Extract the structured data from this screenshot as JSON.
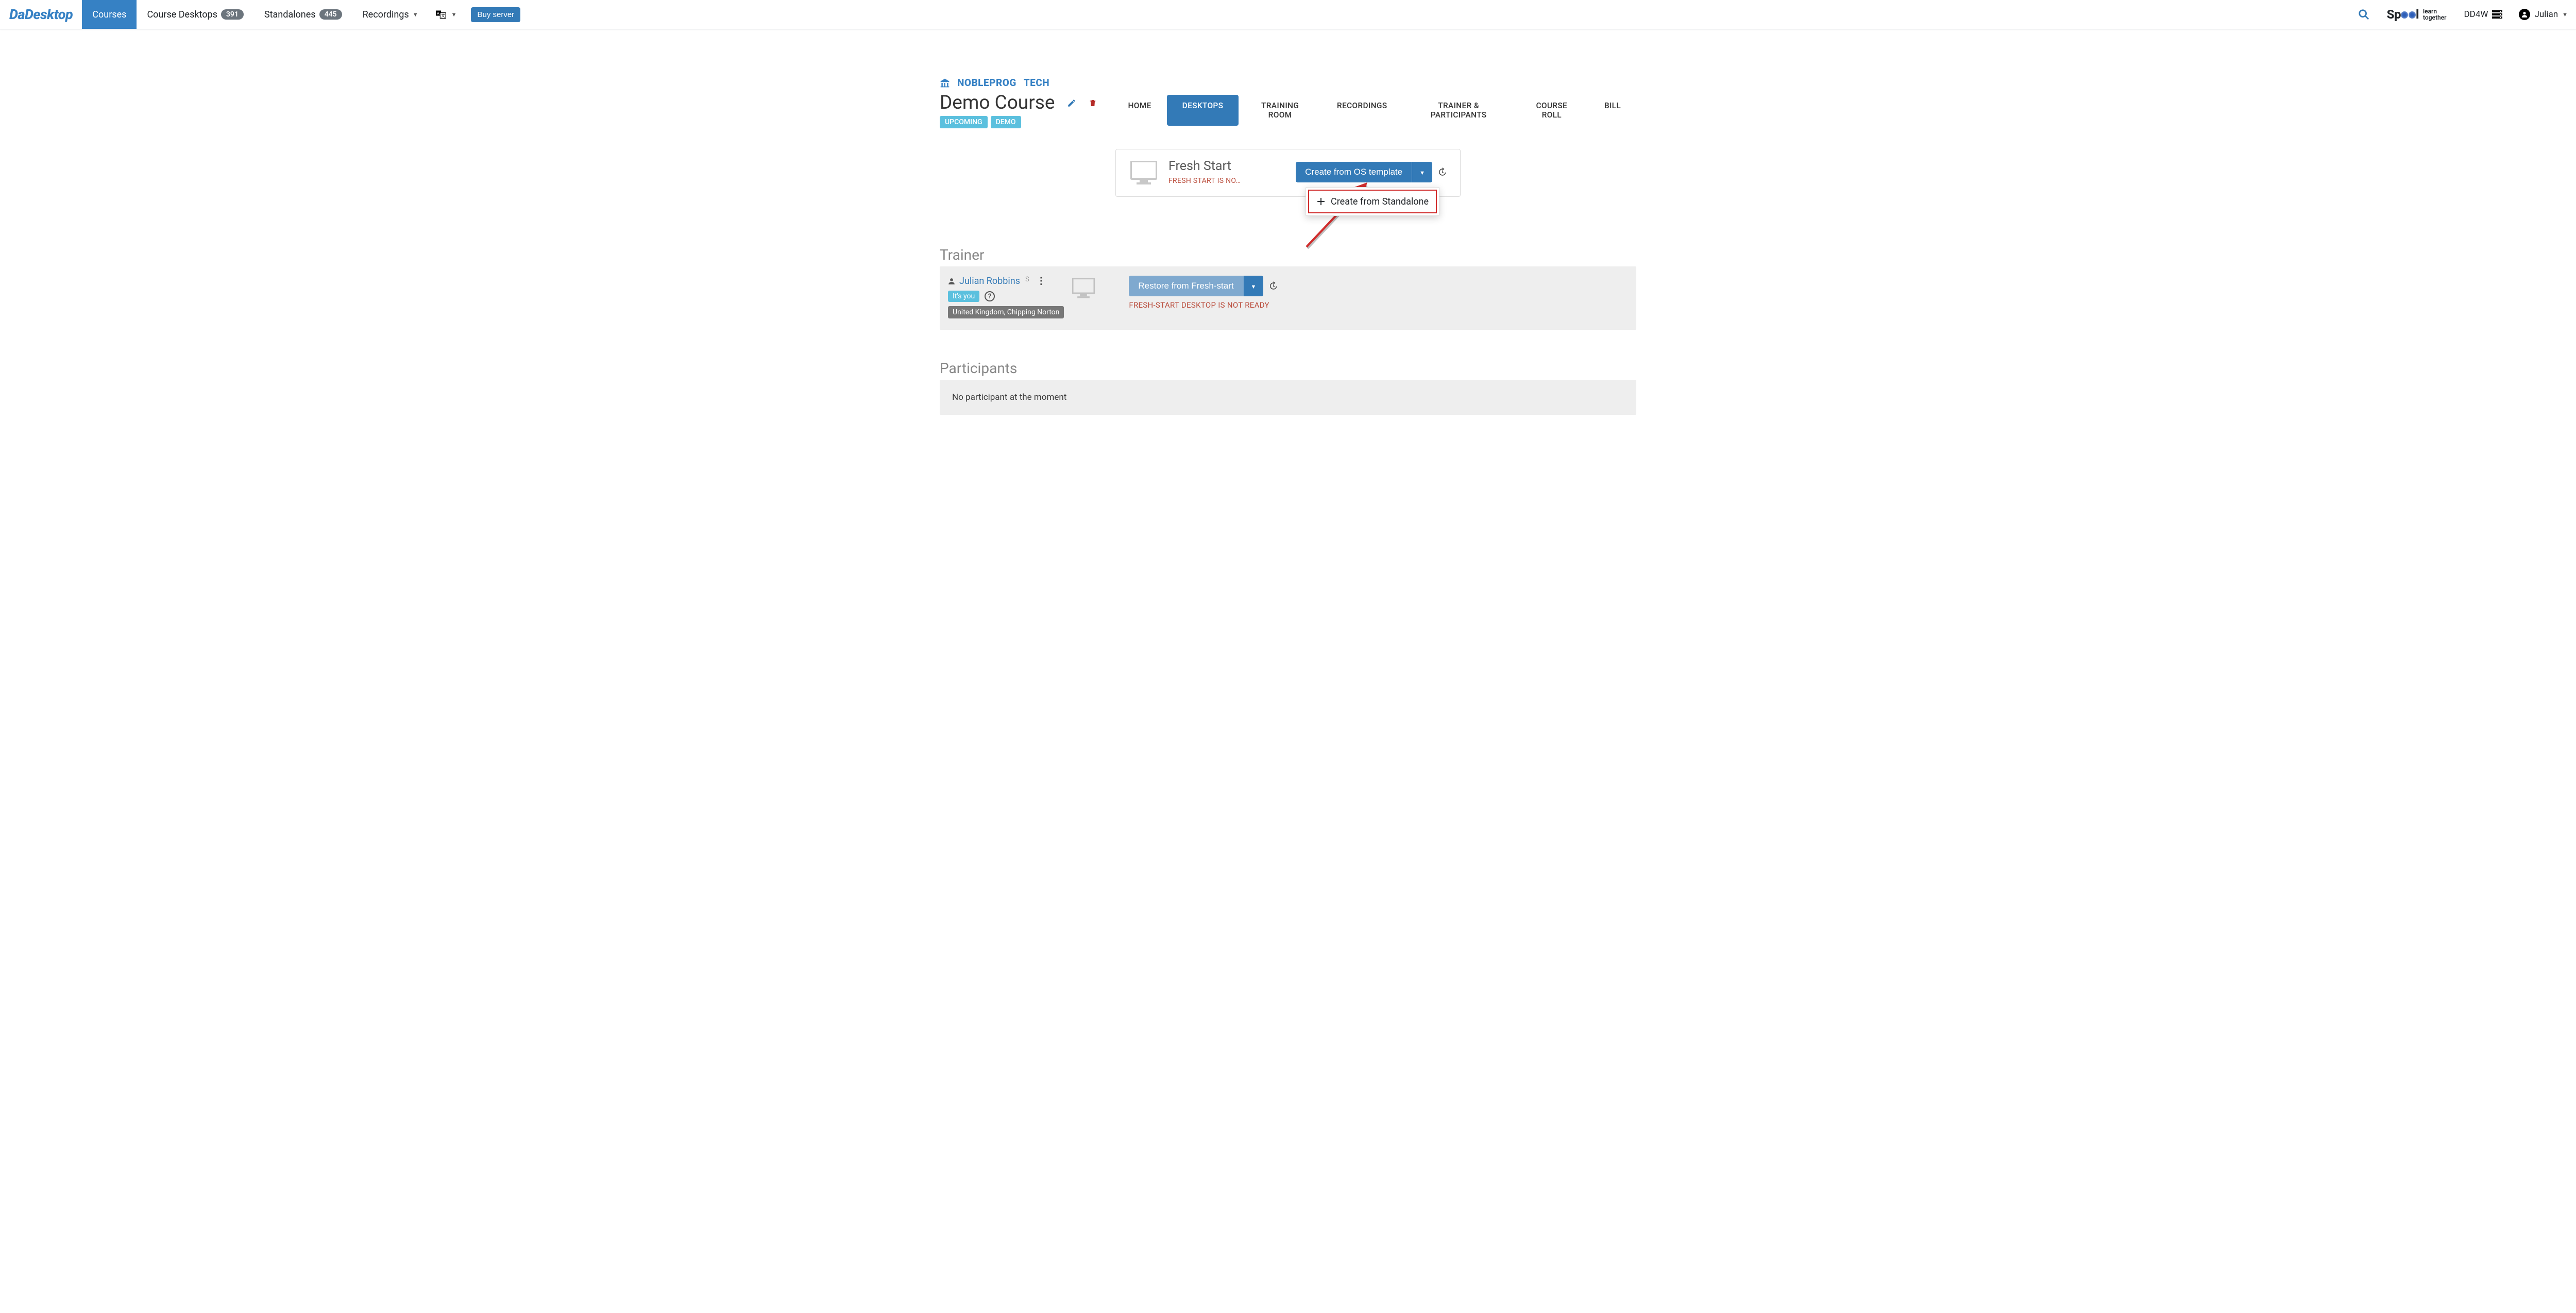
{
  "nav": {
    "brand": "DaDesktop",
    "items": {
      "courses": "Courses",
      "course_desktops": "Course Desktops",
      "course_desktops_badge": "391",
      "standalones": "Standalones",
      "standalones_badge": "445",
      "recordings": "Recordings"
    },
    "buy_server": "Buy server",
    "spool": {
      "main": "Sp",
      "tail": "l",
      "sub1": "learn",
      "sub2": "together"
    },
    "dd4w": "DD4W",
    "user": "Julian"
  },
  "breadcrumb": {
    "org": "NOBLEPROG",
    "tech": "TECH"
  },
  "course": {
    "title": "Demo Course",
    "tags": [
      "UPCOMING",
      "DEMO"
    ]
  },
  "tabs": [
    "HOME",
    "DESKTOPS",
    "TRAINING ROOM",
    "RECORDINGS",
    "TRAINER & PARTICIPANTS",
    "COURSE ROLL",
    "BILL"
  ],
  "fresh": {
    "title": "Fresh Start",
    "warn": "FRESH START IS NO…",
    "create_btn": "Create from OS template",
    "dropdown_item": "Create from Standalone"
  },
  "trainer": {
    "heading": "Trainer",
    "name": "Julian Robbins",
    "s": "S",
    "itsyou": "It's you",
    "location": "United Kingdom, Chipping Norton",
    "restore_btn": "Restore from Fresh-start",
    "warn": "FRESH-START DESKTOP IS NOT READY"
  },
  "participants": {
    "heading": "Participants",
    "empty": "No participant at the moment"
  }
}
